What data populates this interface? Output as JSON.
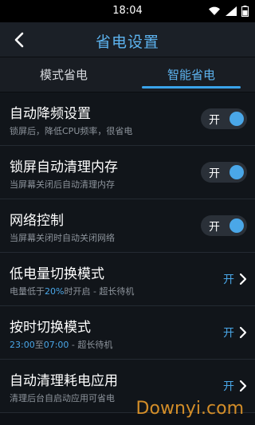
{
  "status": {
    "time": "18:04"
  },
  "header": {
    "title": "省电设置"
  },
  "tabs": [
    {
      "label": "模式省电",
      "active": false
    },
    {
      "label": "智能省电",
      "active": true
    }
  ],
  "rows": [
    {
      "title": "自动降频设置",
      "desc": "锁屏后，降低CPU频率，很省电",
      "control": "toggle",
      "value": "开",
      "on": true
    },
    {
      "title": "锁屏自动清理内存",
      "desc": "当屏幕关闭后自动清理内存",
      "control": "toggle",
      "value": "开",
      "on": true
    },
    {
      "title": "网络控制",
      "desc": "当屏幕关闭时自动关闭网络",
      "control": "toggle",
      "value": "开",
      "on": true
    },
    {
      "title": "低电量切换模式",
      "desc_pre": "电量低于",
      "desc_hl": "20%",
      "desc_post": "时开启 - 超长待机",
      "control": "arrow",
      "value": "开"
    },
    {
      "title": "按时切换模式",
      "desc_hl": "23:00",
      "desc_mid": "至",
      "desc_hl2": "07:00",
      "desc_post": " - 超长待机",
      "control": "arrow",
      "value": "开"
    },
    {
      "title": "自动清理耗电应用",
      "desc": "清理后台自启动应用可省电",
      "control": "arrow",
      "value": "开"
    }
  ],
  "watermark": "Downyi.com",
  "colors": {
    "accent": "#4aa7e8",
    "background": "#11151a"
  }
}
